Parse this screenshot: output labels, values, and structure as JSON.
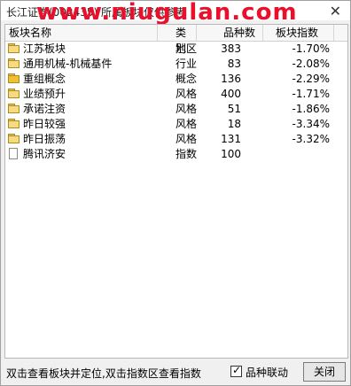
{
  "window": {
    "title": "长江证券(002435)  所属板块仅供参考",
    "watermark": "www.niugulan.com",
    "close_glyph": "✕"
  },
  "table": {
    "columns": [
      "板块名称",
      "类别",
      "品种数",
      "板块指数"
    ],
    "rows": [
      {
        "icon": "folder-icon",
        "name": "江苏板块",
        "category": "地区",
        "count": "383",
        "index": "-1.70%"
      },
      {
        "icon": "folder-icon",
        "name": "通用机械-机械基件",
        "category": "行业",
        "count": "83",
        "index": "-2.08%"
      },
      {
        "icon": "open-folder-icon",
        "name": "重组概念",
        "category": "概念",
        "count": "136",
        "index": "-2.29%"
      },
      {
        "icon": "folder-icon",
        "name": "业绩预升",
        "category": "风格",
        "count": "400",
        "index": "-1.71%"
      },
      {
        "icon": "folder-icon",
        "name": "承诺注资",
        "category": "风格",
        "count": "51",
        "index": "-1.86%"
      },
      {
        "icon": "folder-icon",
        "name": "昨日较强",
        "category": "风格",
        "count": "18",
        "index": "-3.34%"
      },
      {
        "icon": "folder-icon",
        "name": "昨日振荡",
        "category": "风格",
        "count": "131",
        "index": "-3.32%"
      },
      {
        "icon": "document-icon",
        "name": "腾讯济安",
        "category": "指数",
        "count": "100",
        "index": ""
      }
    ]
  },
  "footer": {
    "hint": "双击查看板块并定位,双击指数区查看指数",
    "checkbox_label": "品种联动",
    "checkbox_checked": true,
    "close_button": "关闭"
  }
}
